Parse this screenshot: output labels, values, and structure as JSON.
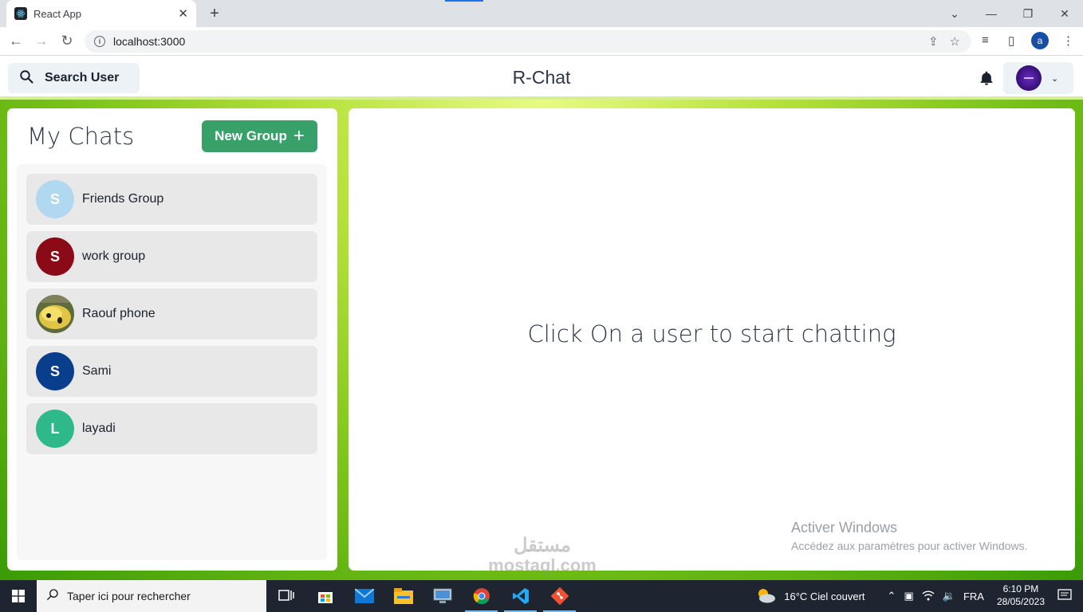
{
  "browser": {
    "tab_title": "React App",
    "url": "localhost:3000",
    "profile_initial": "a"
  },
  "header": {
    "search_label": "Search User",
    "app_title": "R-Chat"
  },
  "chats": {
    "title": "My Chats",
    "new_group_label": "New Group",
    "items": [
      {
        "name": "Friends Group",
        "initial": "S",
        "color": "#b0d8f0"
      },
      {
        "name": "work group",
        "initial": "S",
        "color": "#8b0a17"
      },
      {
        "name": "Raouf phone",
        "initial": "",
        "color": "#d8c25a"
      },
      {
        "name": "Sami",
        "initial": "S",
        "color": "#093e8c"
      },
      {
        "name": "layadi",
        "initial": "L",
        "color": "#2fb88a"
      }
    ]
  },
  "main": {
    "empty_message": "Click On a user to start chatting"
  },
  "activation": {
    "title": "Activer Windows",
    "subtitle": "Accédez aux paramètres pour activer Windows."
  },
  "watermark": {
    "arabic": "مستقل",
    "latin": "mostaql.com"
  },
  "taskbar": {
    "search_placeholder": "Taper ici pour rechercher",
    "weather": "16°C  Ciel couvert",
    "language": "FRA",
    "time": "6:10 PM",
    "date": "28/05/2023"
  }
}
